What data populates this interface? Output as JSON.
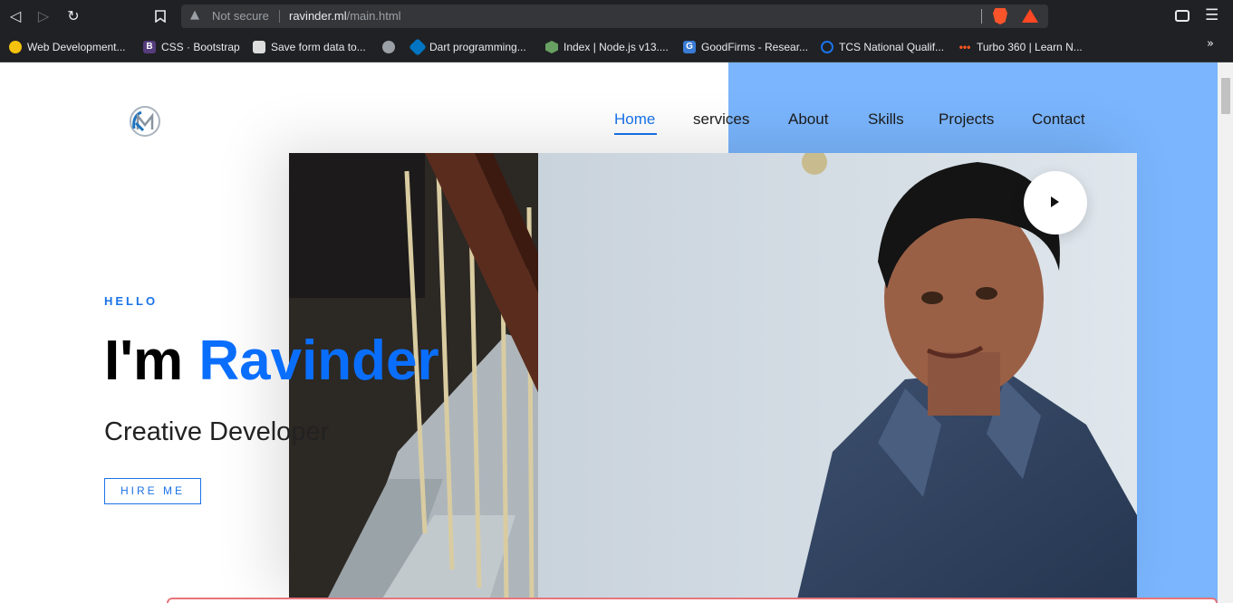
{
  "browser": {
    "url_warning": "Not secure",
    "url_domain": "ravinder.ml",
    "url_path": "/main.html",
    "bookmarks": [
      {
        "label": "Web Development...",
        "icon": "owl-favicon",
        "color": "#f4c20d"
      },
      {
        "label": "CSS · Bootstrap",
        "icon": "bootstrap-favicon",
        "color": "#563d7c"
      },
      {
        "label": "Save form data to...",
        "icon": "avatar-favicon",
        "color": "#dddddd"
      },
      {
        "label": "",
        "icon": "globe-favicon",
        "color": "#9aa0a6"
      },
      {
        "label": "Dart programming...",
        "icon": "dart-favicon",
        "color": "#0175c2"
      },
      {
        "label": "Index | Node.js v13....",
        "icon": "nodejs-favicon",
        "color": "#68a063"
      },
      {
        "label": "GoodFirms - Resear...",
        "icon": "goodfirms-favicon",
        "color": "#3a7bd5"
      },
      {
        "label": "TCS National Qualif...",
        "icon": "tcs-favicon",
        "color": "#1a73e8"
      },
      {
        "label": "Turbo 360 | Learn N...",
        "icon": "turbo-favicon",
        "color": "#ff5722"
      }
    ]
  },
  "nav": {
    "items": [
      "Home",
      "services",
      "About",
      "Skills",
      "Projects",
      "Contact"
    ],
    "active": "Home"
  },
  "hero": {
    "greeting": "HELLO",
    "headline_prefix": "I'm",
    "headline_name": "Ravinder",
    "subtitle": "Creative Developer",
    "cta_label": "HIRE ME"
  },
  "colors": {
    "accent": "#1a73e8",
    "panel": "#7ab5fd"
  }
}
